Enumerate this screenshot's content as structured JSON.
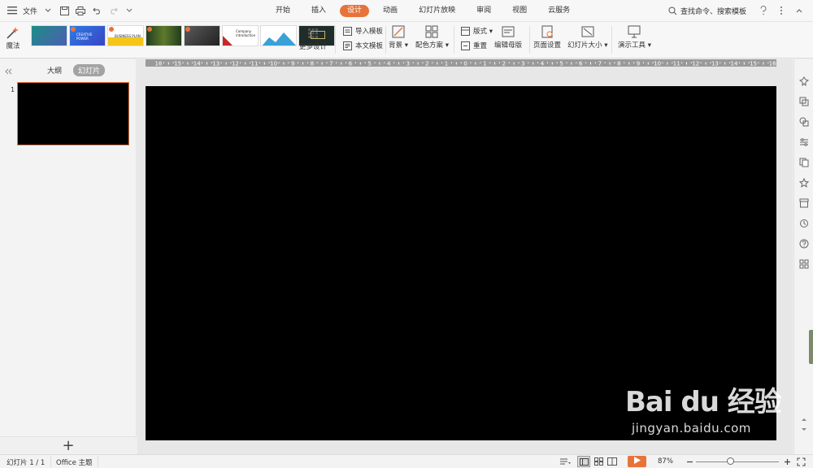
{
  "menubar": {
    "file_label": "文件",
    "tabs": [
      {
        "label": "开始",
        "active": false
      },
      {
        "label": "插入",
        "active": false
      },
      {
        "label": "设计",
        "active": true
      },
      {
        "label": "动画",
        "active": false
      },
      {
        "label": "幻灯片放映",
        "active": false
      },
      {
        "label": "审阅",
        "active": false
      },
      {
        "label": "视图",
        "active": false
      },
      {
        "label": "云服务",
        "active": false
      }
    ],
    "search_label": "查找命令、搜索模板",
    "accent_color": "#e8733a"
  },
  "ribbon": {
    "magic_label": "魔法",
    "templates": [
      {
        "text": "",
        "bg": "#2a9d8f"
      },
      {
        "text": "CREATIVE POWER",
        "bg": "#2d6cdf"
      },
      {
        "text": "BUSINESS PLAN",
        "bg": "#f5c518"
      },
      {
        "text": "",
        "bg": "#3b6b2a"
      },
      {
        "text": "",
        "bg": "#3a3a3a"
      },
      {
        "text": "Company introduction",
        "bg": "#ffffff"
      },
      {
        "text": "",
        "bg": "#ffffff"
      },
      {
        "text": "",
        "bg": "#1f2d2a"
      }
    ],
    "more_designs_label": "更多设计",
    "import_template_label": "导入模板",
    "this_template_label": "本文模板",
    "background_label": "背景",
    "color_scheme_label": "配色方案",
    "layout_label": "版式",
    "reset_label": "重置",
    "edit_master_label": "编辑母版",
    "page_setup_label": "页面设置",
    "slide_size_label": "幻灯片大小",
    "presentation_tools_label": "演示工具"
  },
  "left_panel": {
    "outline_tab": "大纲",
    "slides_tab": "幻灯片",
    "slide_number": "1",
    "add_symbol": "+"
  },
  "ruler": {
    "labels": [
      "16",
      "15",
      "14",
      "13",
      "12",
      "11",
      "10",
      "9",
      "8",
      "7",
      "6",
      "5",
      "4",
      "3",
      "2",
      "1",
      "0",
      "1",
      "2",
      "3",
      "4",
      "5",
      "6",
      "7",
      "8",
      "9",
      "10",
      "11",
      "12",
      "13",
      "14",
      "15",
      "16"
    ]
  },
  "watermark": {
    "main": "Bai du 经验",
    "sub": "jingyan.baidu.com"
  },
  "status": {
    "slide_count": "幻灯片 1 / 1",
    "theme": "Office 主题",
    "zoom": "87%",
    "zoom_level_percent": 87
  }
}
